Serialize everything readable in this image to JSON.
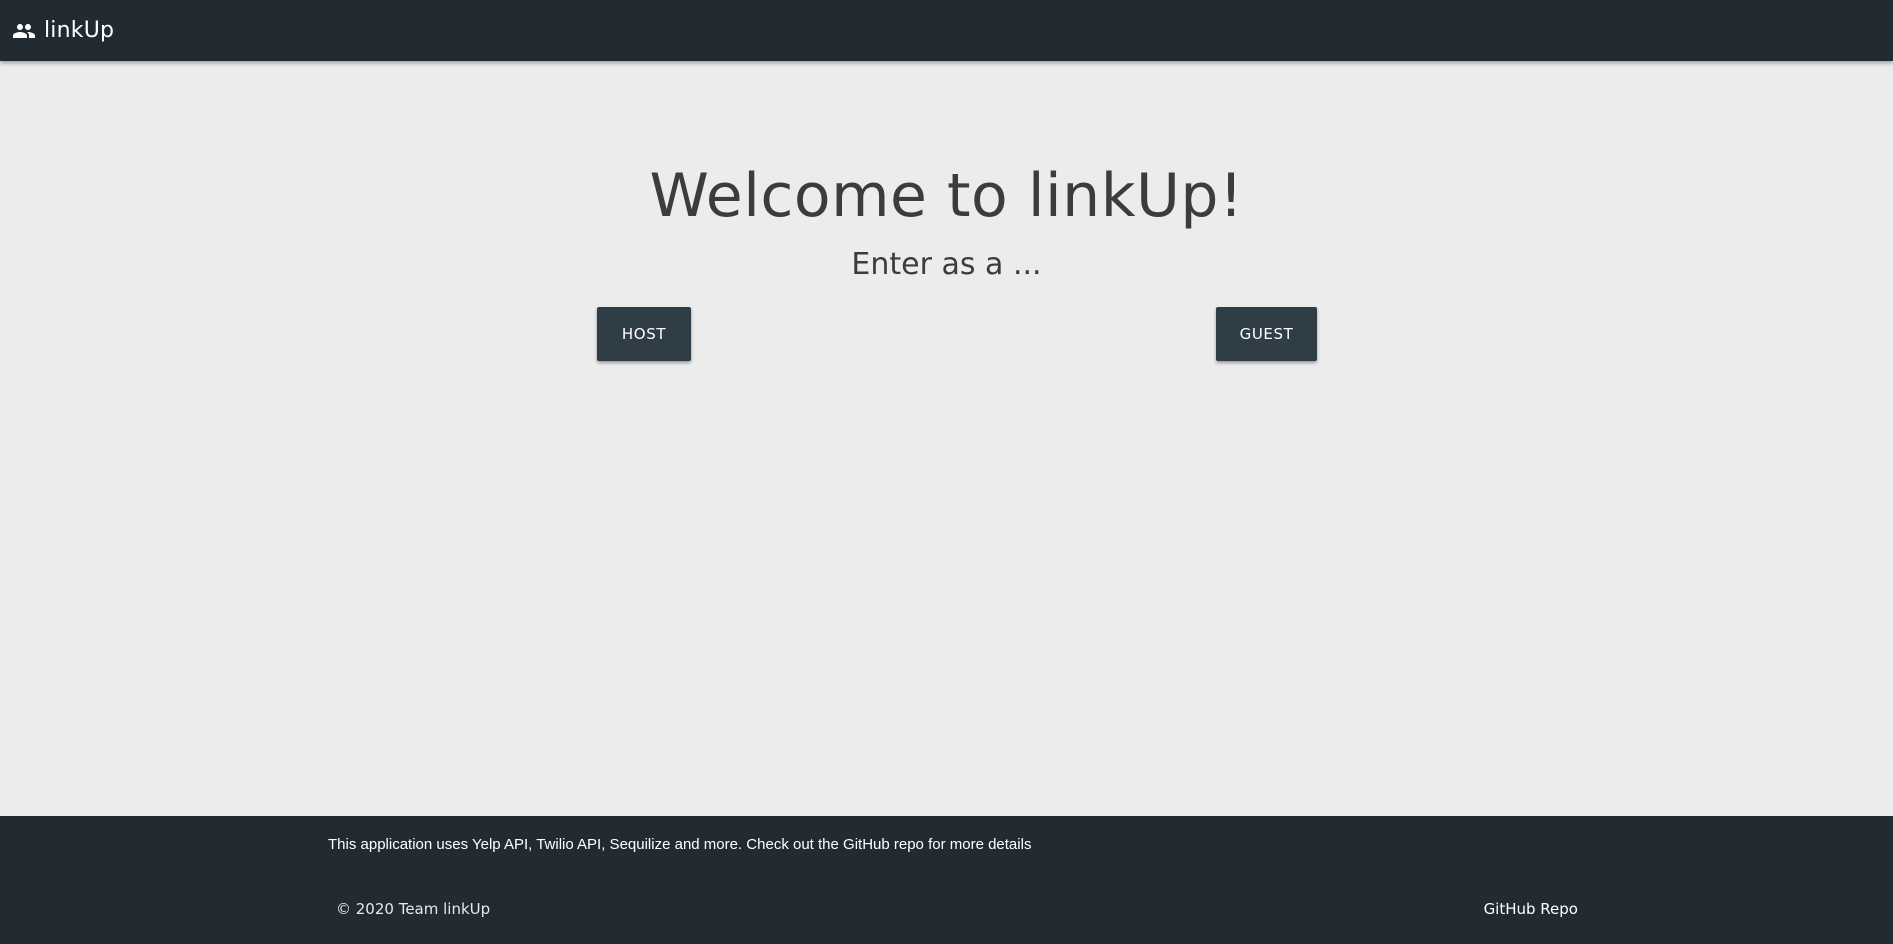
{
  "navbar": {
    "brand_icon": "people-icon",
    "brand_text": "linkUp",
    "background": "#222b31"
  },
  "main": {
    "title": "Welcome to linkUp!",
    "subtitle": "Enter as a ...",
    "buttons": {
      "host_label": "HOST",
      "guest_label": "GUEST"
    },
    "background": "#ececec",
    "button_color": "#2f3d47"
  },
  "footer": {
    "description": "This application uses Yelp API, Twilio API, Sequilize and more. Check out the GitHub repo for more details",
    "copyright": "© 2020 Team linkUp",
    "github_link": "GitHub Repo",
    "background": "#222b31"
  }
}
